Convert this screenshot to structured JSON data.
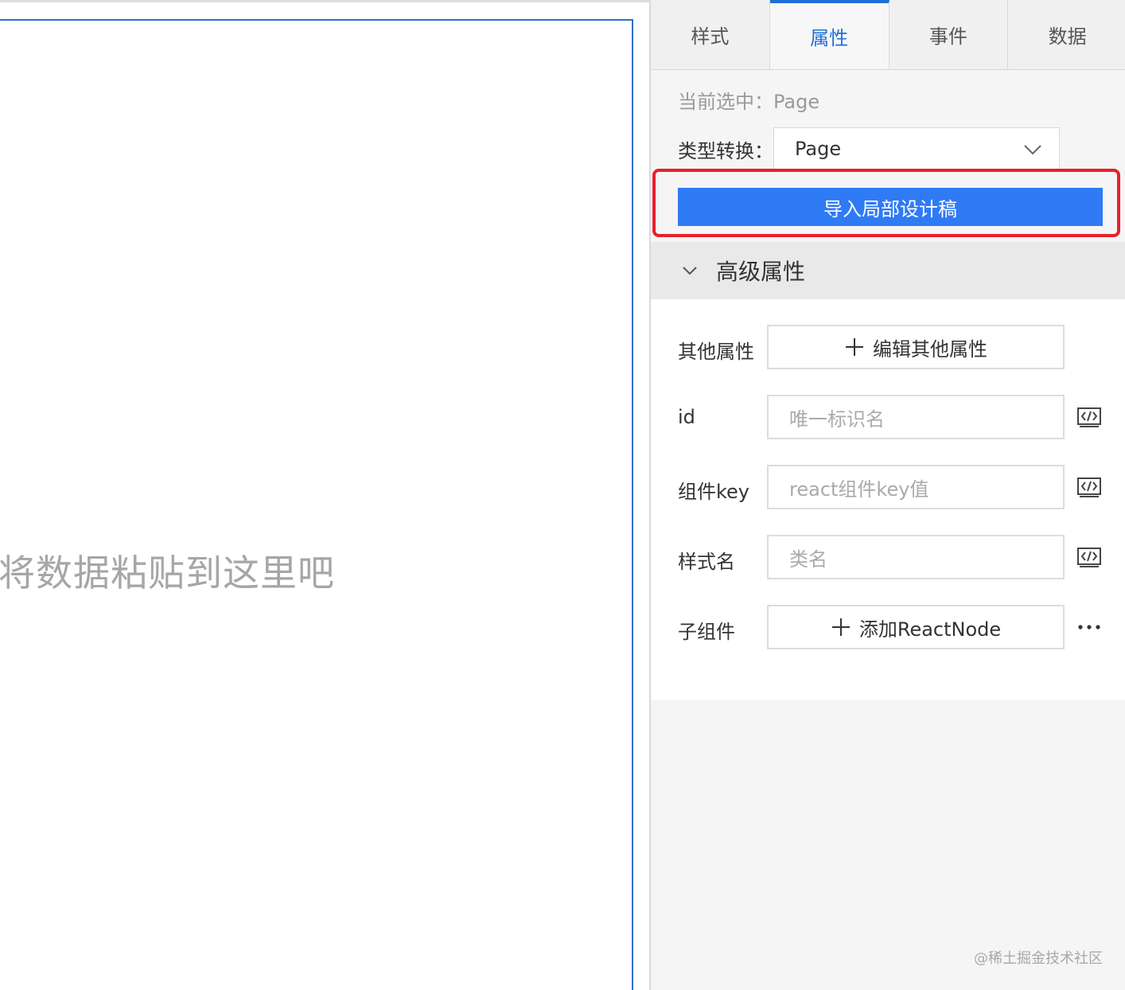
{
  "canvas": {
    "hint": "将数据粘贴到这里吧"
  },
  "tabs": [
    {
      "label": "样式",
      "active": false
    },
    {
      "label": "属性",
      "active": true
    },
    {
      "label": "事件",
      "active": false
    },
    {
      "label": "数据",
      "active": false
    }
  ],
  "selection": {
    "current_label": "当前选中：",
    "current_value": "Page"
  },
  "type_convert": {
    "label": "类型转换：",
    "value": "Page"
  },
  "import_button": {
    "label": "导入局部设计稿"
  },
  "advanced": {
    "title": "高级属性",
    "rows": [
      {
        "label": "其他属性",
        "kind": "button",
        "text": "编辑其他属性"
      },
      {
        "label": "id",
        "kind": "input",
        "placeholder": "唯一标识名"
      },
      {
        "label": "组件key",
        "kind": "input",
        "placeholder": "react组件key值"
      },
      {
        "label": "样式名",
        "kind": "input",
        "placeholder": "类名"
      },
      {
        "label": "子组件",
        "kind": "button",
        "text": "添加ReactNode"
      }
    ]
  },
  "colors": {
    "accent": "#1f6fd8",
    "primary_button": "#2f7af5",
    "highlight_border": "#e8202a",
    "canvas_border": "#2f6fc9"
  },
  "watermark": "@稀土掘金技术社区"
}
